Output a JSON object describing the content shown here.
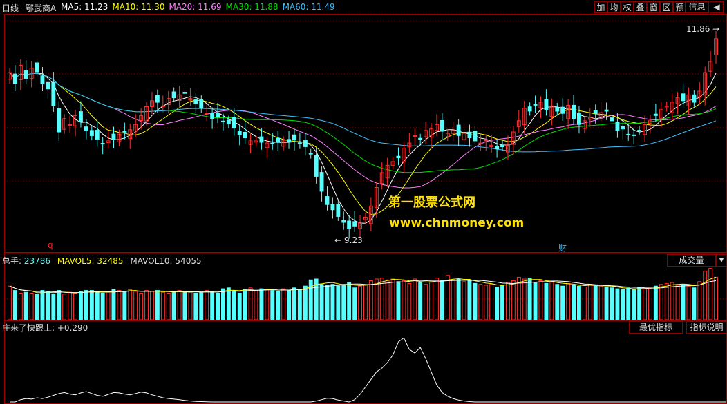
{
  "header": {
    "period_label": "日线",
    "stock_name": "鄂武商A",
    "ma": [
      {
        "label": "MA5:",
        "value": "11.23",
        "color": "#ffffff"
      },
      {
        "label": "MA10:",
        "value": "11.30",
        "color": "#ffff00"
      },
      {
        "label": "MA20:",
        "value": "11.69",
        "color": "#ff80ff"
      },
      {
        "label": "MA30:",
        "value": "11.88",
        "color": "#00e000"
      },
      {
        "label": "MA60:",
        "value": "11.49",
        "color": "#40c0ff"
      }
    ],
    "toolbar": [
      {
        "label": "加",
        "name": "add-button"
      },
      {
        "label": "均",
        "name": "average-button"
      },
      {
        "label": "权",
        "name": "rights-button"
      },
      {
        "label": "叠",
        "name": "overlay-button"
      },
      {
        "label": "窗",
        "name": "window-button"
      },
      {
        "label": "区",
        "name": "range-button"
      },
      {
        "label": "预",
        "name": "preview-button"
      }
    ],
    "info_label": "信息",
    "expand_icon": "triangle-left-icon"
  },
  "price_panel": {
    "high_label": "11.86",
    "low_label": "9.23",
    "marker_q": "q",
    "marker_cai": "财",
    "watermark_title": "第一股票公式网",
    "watermark_url": "www.chnmoney.com"
  },
  "volume_panel": {
    "title_label": "总手:",
    "title_value": "23786",
    "mavol5_label": "MAVOL5:",
    "mavol5_value": "32485",
    "mavol10_label": "MAVOL10:",
    "mavol10_value": "54055",
    "selector_label": "成交量",
    "selector_icon": "dropdown-triangle-icon"
  },
  "indicator_panel": {
    "title": "庄来了快跟上:",
    "value": "+0.290",
    "best_button": "最优指标",
    "explain_button": "指标说明"
  },
  "colors": {
    "up": "#ff3030",
    "down": "#54ffff",
    "ma5": "#ffffff",
    "ma10": "#ffff00",
    "ma20": "#ff80ff",
    "ma30": "#00e000",
    "ma60": "#40c0ff",
    "grid": "#8b0000"
  },
  "chart_data": {
    "type": "candlestick",
    "y_unit": "price",
    "ylim": [
      9.1,
      12.1
    ],
    "closes": [
      11.4,
      11.25,
      11.5,
      11.32,
      11.46,
      11.41,
      11.25,
      11.18,
      10.95,
      10.6,
      10.78,
      10.7,
      10.82,
      10.74,
      10.62,
      10.55,
      10.5,
      10.44,
      10.48,
      10.5,
      10.57,
      10.6,
      10.63,
      10.7,
      10.82,
      10.94,
      11.02,
      11.0,
      10.95,
      11.05,
      11.06,
      11.1,
      11.12,
      11.05,
      10.98,
      10.92,
      10.85,
      10.78,
      10.8,
      10.74,
      10.71,
      10.65,
      10.56,
      10.52,
      10.48,
      10.48,
      10.46,
      10.45,
      10.44,
      10.46,
      10.48,
      10.47,
      10.49,
      10.45,
      10.4,
      10.3,
      10.0,
      9.8,
      9.62,
      9.55,
      9.46,
      9.38,
      9.3,
      9.33,
      9.38,
      9.45,
      9.6,
      9.85,
      10.05,
      10.15,
      10.2,
      10.25,
      10.38,
      10.45,
      10.55,
      10.5,
      10.62,
      10.64,
      10.7,
      10.61,
      10.58,
      10.62,
      10.55,
      10.58,
      10.52,
      10.48,
      10.45,
      10.49,
      10.42,
      10.37,
      10.4,
      10.43,
      10.6,
      10.75,
      10.92,
      10.88,
      10.96,
      11.0,
      10.9,
      10.95,
      10.88,
      10.85,
      10.96,
      10.78,
      10.7,
      10.75,
      10.8,
      10.85,
      10.86,
      10.88,
      10.75,
      10.62,
      10.64,
      10.56,
      10.55,
      10.62,
      10.7,
      10.75,
      10.82,
      10.9,
      10.95,
      11.0,
      11.06,
      11.02,
      11.1,
      11.0,
      11.15,
      11.4,
      11.55,
      11.86
    ],
    "candles_note": "",
    "volume": [
      38000,
      33000,
      30000,
      31000,
      30000,
      29000,
      33000,
      32000,
      29000,
      33000,
      29000,
      31000,
      30000,
      32000,
      33000,
      33000,
      31000,
      30000,
      31000,
      34000,
      33000,
      32000,
      34000,
      32000,
      30000,
      33000,
      32000,
      33000,
      31000,
      30000,
      31000,
      33000,
      32000,
      31000,
      30000,
      31000,
      33000,
      32000,
      30000,
      35000,
      36000,
      33000,
      30000,
      34000,
      36000,
      33000,
      35000,
      34000,
      33000,
      32000,
      35000,
      33000,
      36000,
      34000,
      38000,
      45000,
      46000,
      40000,
      39000,
      40000,
      38000,
      40000,
      42000,
      36000,
      38000,
      39000,
      44000,
      46000,
      47000,
      45000,
      46000,
      43000,
      44000,
      41000,
      46000,
      42000,
      40000,
      43000,
      47000,
      44000,
      50000,
      45000,
      46000,
      43000,
      44000,
      41000,
      40000,
      39000,
      40000,
      37000,
      39000,
      42000,
      44000,
      48000,
      46000,
      47000,
      42000,
      44000,
      41000,
      43000,
      40000,
      38000,
      41000,
      39000,
      38000,
      37000,
      40000,
      39000,
      38000,
      37000,
      36000,
      35000,
      34000,
      36000,
      34000,
      37000,
      35000,
      36000,
      38000,
      40000,
      41000,
      42000,
      39000,
      40000,
      38000,
      36000,
      43000,
      55000,
      58000,
      48000
    ],
    "indicator": [
      0,
      0,
      0.12,
      0.18,
      0.15,
      0.22,
      0.18,
      0.25,
      0.35,
      0.45,
      0.5,
      0.42,
      0.38,
      0.48,
      0.55,
      0.45,
      0.35,
      0.3,
      0.4,
      0.5,
      0.48,
      0.42,
      0.38,
      0.45,
      0.52,
      0.48,
      0.38,
      0.3,
      0.22,
      0.18,
      0.15,
      0.12,
      0.08,
      0.05,
      0.03,
      0.02,
      0.01,
      0,
      0,
      0,
      0,
      0,
      0,
      0,
      0,
      0,
      0,
      0,
      0,
      0,
      0,
      0,
      0,
      0,
      0,
      0,
      0.05,
      0.12,
      0.2,
      0.18,
      0.1,
      0.05,
      0,
      0.12,
      0.4,
      0.8,
      1.2,
      1.6,
      1.8,
      2.1,
      2.5,
      3.2,
      3.4,
      2.8,
      2.6,
      2.9,
      2.3,
      1.6,
      0.9,
      0.5,
      0.3,
      0.18,
      0.1,
      0.05,
      0.02,
      0,
      0,
      0,
      0,
      0,
      0,
      0,
      0,
      0,
      0,
      0,
      0,
      0,
      0,
      0,
      0,
      0,
      0,
      0,
      0,
      0,
      0,
      0,
      0,
      0,
      0,
      0,
      0,
      0,
      0,
      0,
      0,
      0,
      0,
      0,
      0,
      0,
      0,
      0,
      0,
      0,
      0,
      0,
      0,
      0,
      0,
      0
    ]
  }
}
